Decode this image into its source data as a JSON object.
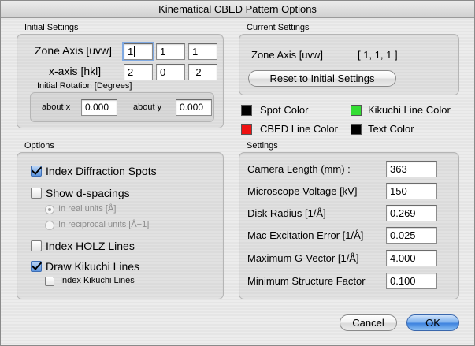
{
  "window": {
    "title": "Kinematical CBED Pattern Options"
  },
  "initial_settings": {
    "group_label": "Initial Settings",
    "zone_axis_label": "Zone Axis [uvw]",
    "zone_axis": [
      "1",
      "1",
      "1"
    ],
    "x_axis_label": "x-axis [hkl]",
    "x_axis": [
      "2",
      "0",
      "-2"
    ],
    "rotation_label": "Initial Rotation [Degrees]",
    "about_x_label": "about x",
    "about_x": "0.000",
    "about_y_label": "about y",
    "about_y": "0.000"
  },
  "current_settings": {
    "group_label": "Current Settings",
    "zone_axis_label": "Zone Axis [uvw]",
    "zone_axis_value": "[ 1, 1, 1 ]",
    "reset_label": "Reset to Initial Settings"
  },
  "colors": {
    "spot_label": "Spot Color",
    "spot_color": "#000000",
    "kikuchi_label": "Kikuchi Line Color",
    "kikuchi_color": "#33dd33",
    "cbed_label": "CBED Line Color",
    "cbed_color": "#ee1111",
    "text_label": "Text Color",
    "text_color": "#000000"
  },
  "options": {
    "group_label": "Options",
    "index_spots": {
      "label": "Index Diffraction Spots",
      "checked": true
    },
    "show_d": {
      "label": "Show d-spacings",
      "checked": false
    },
    "real_units": {
      "label": "In real units [Å]",
      "selected": true,
      "enabled": false
    },
    "reciprocal_units": {
      "label": "In reciprocal units [Å−1]",
      "selected": false,
      "enabled": false
    },
    "index_holz": {
      "label": "Index HOLZ Lines",
      "checked": false
    },
    "draw_kikuchi": {
      "label": "Draw Kikuchi Lines",
      "checked": true
    },
    "index_kikuchi": {
      "label": "Index Kikuchi Lines",
      "checked": false
    }
  },
  "settings": {
    "group_label": "Settings",
    "rows": [
      {
        "label": "Camera Length (mm) :",
        "value": "363"
      },
      {
        "label": "Microscope Voltage [kV]",
        "value": "150"
      },
      {
        "label": "Disk Radius [1/Å]",
        "value": "0.269"
      },
      {
        "label": "Mac Excitation Error [1/Å]",
        "value": "0.025"
      },
      {
        "label": "Maximum G-Vector [1/Å]",
        "value": "4.000"
      },
      {
        "label": "Minimum Structure Factor",
        "value": "0.100"
      }
    ]
  },
  "buttons": {
    "cancel": "Cancel",
    "ok": "OK"
  }
}
